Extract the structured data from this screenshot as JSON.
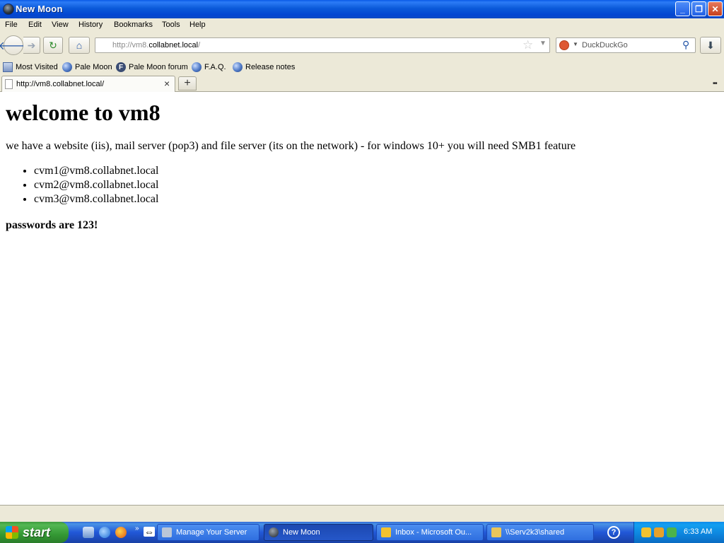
{
  "window": {
    "title": "New Moon"
  },
  "menu": [
    "File",
    "Edit",
    "View",
    "History",
    "Bookmarks",
    "Tools",
    "Help"
  ],
  "nav": {
    "url_prefix": "http://vm8.",
    "url_domain": "collabnet.local",
    "url_suffix": "/",
    "search_placeholder": "DuckDuckGo"
  },
  "bookmarks": [
    "Most Visited",
    "Pale Moon",
    "Pale Moon forum",
    "F.A.Q.",
    "Release notes"
  ],
  "tab": {
    "title": "http://vm8.collabnet.local/"
  },
  "page": {
    "heading": "welcome to vm8",
    "intro": "we have a website (iis), mail server (pop3) and file server (its on the network) - for windows 10+ you will need SMB1 feature",
    "emails": [
      "cvm1@vm8.collabnet.local",
      "cvm2@vm8.collabnet.local",
      "cvm3@vm8.collabnet.local"
    ],
    "passwords": "passwords are 123!"
  },
  "taskbar": {
    "start": "start",
    "tasks": [
      "Manage Your Server",
      "New Moon",
      "Inbox - Microsoft Ou...",
      "\\\\Serv2k3\\shared"
    ],
    "clock": "6:33 AM"
  }
}
